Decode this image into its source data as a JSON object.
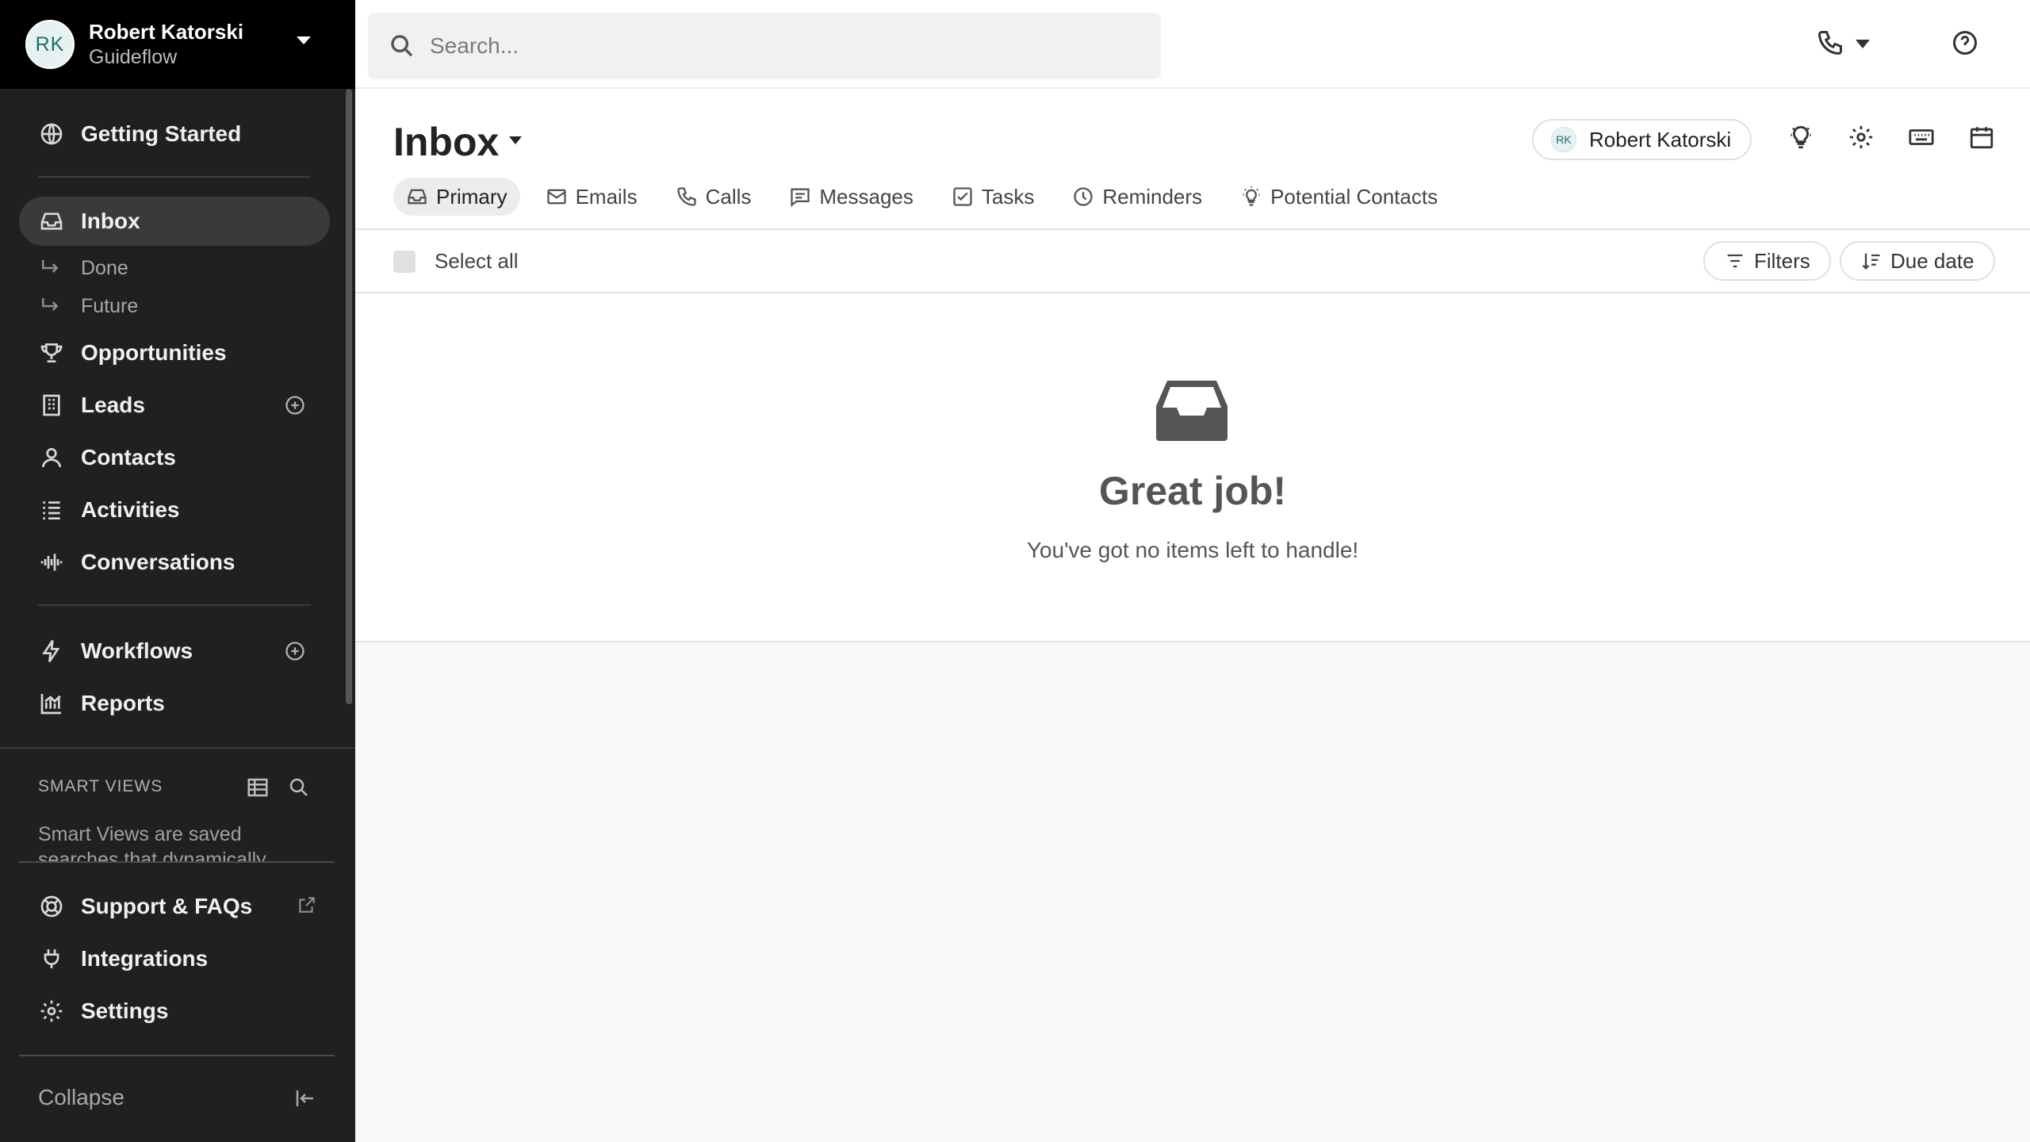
{
  "account": {
    "initials": "RK",
    "name": "Robert Katorski",
    "org": "Guideflow"
  },
  "sidebar": {
    "getting_started": "Getting Started",
    "inbox": "Inbox",
    "done": "Done",
    "future": "Future",
    "opportunities": "Opportunities",
    "leads": "Leads",
    "contacts": "Contacts",
    "activities": "Activities",
    "conversations": "Conversations",
    "workflows": "Workflows",
    "reports": "Reports",
    "smart_views_title": "SMART VIEWS",
    "smart_views_desc": "Smart Views are saved searches that dynamically",
    "support": "Support & FAQs",
    "integrations": "Integrations",
    "settings": "Settings",
    "collapse": "Collapse"
  },
  "search": {
    "placeholder": "Search..."
  },
  "header": {
    "title": "Inbox",
    "user_initials": "RK",
    "user_name": "Robert Katorski"
  },
  "tabs": [
    {
      "label": "Primary",
      "icon": "inbox-icon"
    },
    {
      "label": "Emails",
      "icon": "mail-icon"
    },
    {
      "label": "Calls",
      "icon": "phone-icon"
    },
    {
      "label": "Messages",
      "icon": "message-icon"
    },
    {
      "label": "Tasks",
      "icon": "checkbox-icon"
    },
    {
      "label": "Reminders",
      "icon": "clock-icon"
    },
    {
      "label": "Potential Contacts",
      "icon": "lightbulb-icon"
    }
  ],
  "toolbar": {
    "select_all": "Select all",
    "filters": "Filters",
    "sort": "Due date"
  },
  "empty": {
    "title": "Great job!",
    "subtitle": "You've got no items left to handle!"
  }
}
